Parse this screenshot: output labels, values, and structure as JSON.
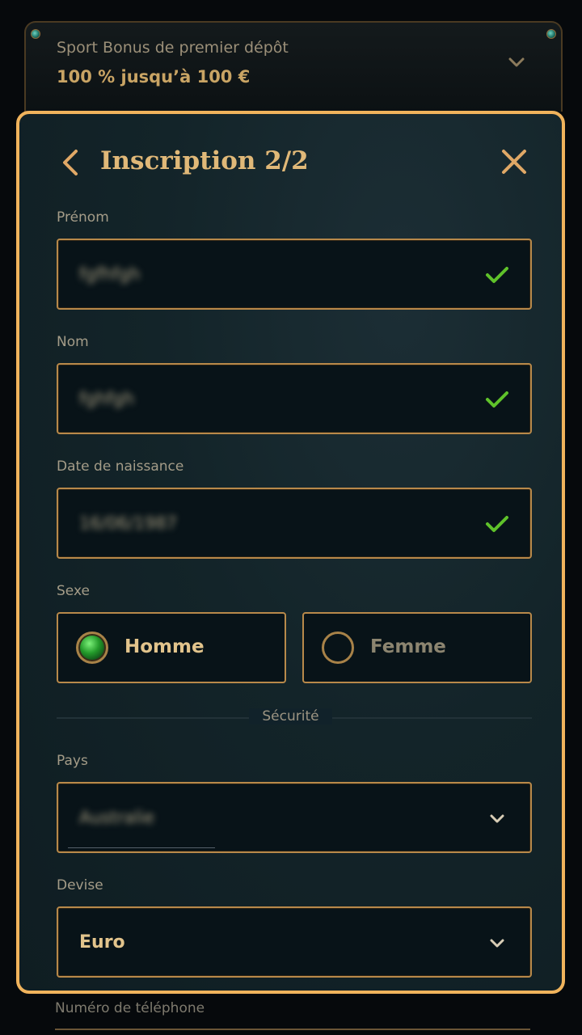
{
  "bonus": {
    "title": "Sport Bonus de premier dépôt",
    "amount": "100 % jusqu’à 100 €"
  },
  "modal": {
    "title": "Inscription 2/2",
    "fields": {
      "prenom": {
        "label": "Prénom",
        "value": "fgfhfgh"
      },
      "nom": {
        "label": "Nom",
        "value": "fghfgh"
      },
      "date": {
        "label": "Date de naissance",
        "value": "16/06/1987"
      }
    },
    "sexe": {
      "label": "Sexe",
      "options": [
        "Homme",
        "Femme"
      ],
      "selected": "Homme"
    },
    "section_divider": "Sécurité",
    "pays": {
      "label": "Pays",
      "value": "Australie"
    },
    "devise": {
      "label": "Devise",
      "value": "Euro"
    }
  },
  "below": {
    "phone_label": "Numéro de téléphone"
  },
  "colors": {
    "accent_border": "#f0b35c",
    "field_border": "#b8894a",
    "check": "#5fc22a",
    "title": "#e0b878"
  }
}
